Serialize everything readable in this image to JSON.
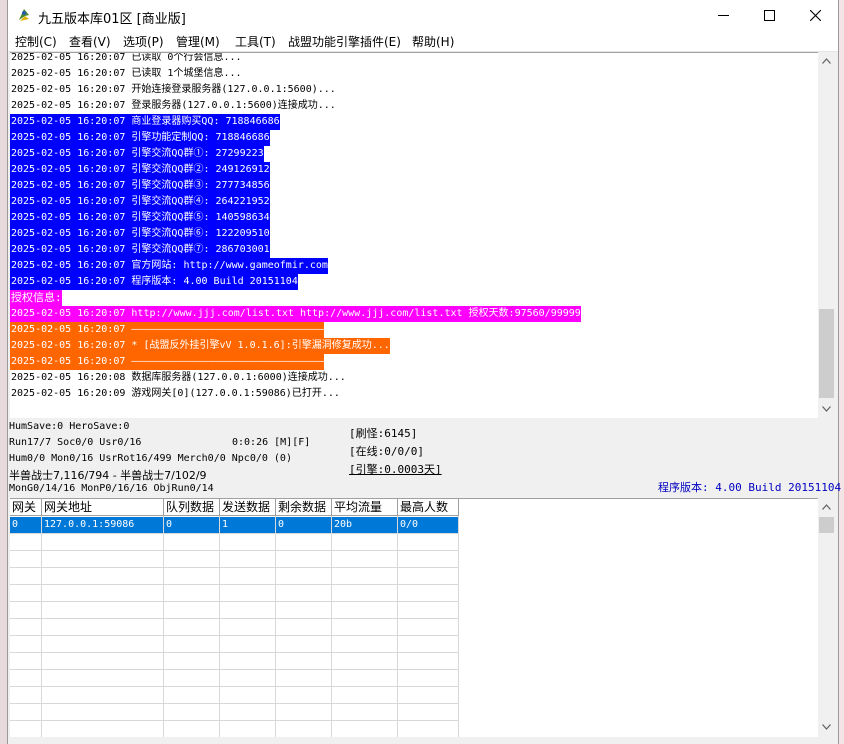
{
  "window": {
    "title": "九五版本库01区 [商业版]"
  },
  "menu": [
    {
      "label": "控制(C)"
    },
    {
      "label": "查看(V)"
    },
    {
      "label": "选项(P)"
    },
    {
      "label": "管理(M)"
    },
    {
      "label": "工具(T)"
    },
    {
      "label": "战盟功能引擎插件(E)"
    },
    {
      "label": "帮助(H)"
    }
  ],
  "colors": {
    "blue": "#0000ff",
    "magenta": "#ff00ff",
    "orange": "#ff6600",
    "accent": "#0078d7"
  },
  "log": [
    {
      "text": "2025-02-05 16:20:07 已读取 0个行会信息...",
      "style": "normal"
    },
    {
      "text": "2025-02-05 16:20:07 已读取 1个城堡信息...",
      "style": "normal"
    },
    {
      "text": "2025-02-05 16:20:07 开始连接登录服务器(127.0.0.1:5600)...",
      "style": "normal"
    },
    {
      "text": "2025-02-05 16:20:07 登录服务器(127.0.0.1:5600)连接成功...",
      "style": "normal"
    },
    {
      "text": "2025-02-05 16:20:07 商业登录器购买QQ: 718846686",
      "style": "blue"
    },
    {
      "text": "2025-02-05 16:20:07 引擎功能定制QQ: 718846686",
      "style": "blue"
    },
    {
      "text": "2025-02-05 16:20:07 引擎交流QQ群①: 27299223",
      "style": "blue"
    },
    {
      "text": "2025-02-05 16:20:07 引擎交流QQ群②: 249126912",
      "style": "blue"
    },
    {
      "text": "2025-02-05 16:20:07 引擎交流QQ群③: 277734856",
      "style": "blue"
    },
    {
      "text": "2025-02-05 16:20:07 引擎交流QQ群④: 264221952",
      "style": "blue"
    },
    {
      "text": "2025-02-05 16:20:07 引擎交流QQ群⑤: 140598634",
      "style": "blue"
    },
    {
      "text": "2025-02-05 16:20:07 引擎交流QQ群⑥: 122209510",
      "style": "blue"
    },
    {
      "text": "2025-02-05 16:20:07 引擎交流QQ群⑦: 286703001",
      "style": "blue"
    },
    {
      "text": "2025-02-05 16:20:07 官方网站: http://www.gameofmir.com",
      "style": "blue"
    },
    {
      "text": "2025-02-05 16:20:07 程序版本: 4.00 Build 20151104",
      "style": "blue"
    },
    {
      "text": "授权信息:",
      "style": "magenta"
    },
    {
      "text": "2025-02-05 16:20:07 http://www.jjj.com/list.txt http://www.jjj.com/list.txt 授权天数:97560/99999",
      "style": "magenta"
    },
    {
      "text": "2025-02-05 16:20:07 ————————————————————————————————",
      "style": "orange"
    },
    {
      "text": "2025-02-05 16:20:07 * [战盟反外挂引擎vV 1.0.1.6]:引擎漏洞修复成功...",
      "style": "orange"
    },
    {
      "text": "2025-02-05 16:20:07 ————————————————————————————————",
      "style": "orange"
    },
    {
      "text": "2025-02-05 16:20:08 数据库服务器(127.0.0.1:6000)连接成功...",
      "style": "normal"
    },
    {
      "text": "2025-02-05 16:20:09 游戏网关[0](127.0.0.1:59086)已打开...",
      "style": "normal"
    }
  ],
  "status": {
    "line1": "HumSave:0 HeroSave:0",
    "line2": "Run17/7 Soc0/0 Usr0/16",
    "timer": "0:0:26 [M][F]",
    "line3": "Hum0/0 Mon0/16 UsrRot16/499 Merch0/0 Npc0/0 (0)",
    "line4": "半兽战士7,116/794 - 半兽战士7/102/9",
    "line5": "MonG0/14/16 MonP0/16/16 ObjRun0/14",
    "refresh": "[刷怪:6145]",
    "online": "[在线:0/0/0]",
    "engine": "[引擎:0.0003天]",
    "version": "程序版本: 4.00 Build 20151104"
  },
  "table": {
    "columns": [
      "网关",
      "网关地址",
      "队列数据",
      "发送数据",
      "剩余数据",
      "平均流量",
      "最高人数"
    ],
    "rows": [
      [
        "0",
        "127.0.0.1:59086",
        "0",
        "1",
        "0",
        "20b",
        "0/0"
      ]
    ]
  }
}
